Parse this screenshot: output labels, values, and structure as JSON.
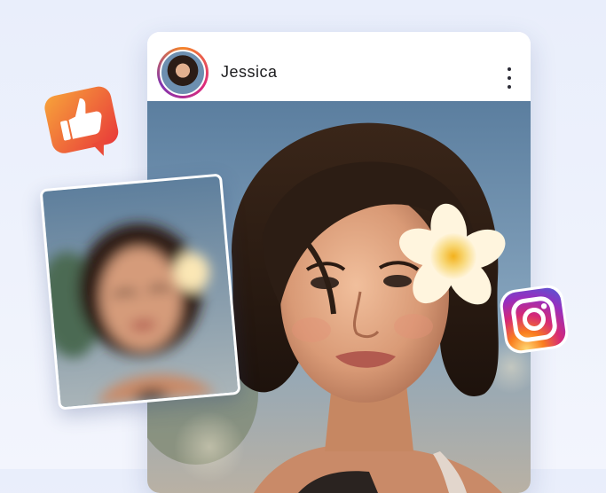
{
  "post": {
    "username": "Jessica",
    "more_icon": "more-vertical-icon",
    "avatar_icon": "profile-avatar"
  },
  "badges": {
    "like_icon": "thumbs-up-icon",
    "instagram_icon": "instagram-icon"
  },
  "colors": {
    "like_gradient_start": "#f7a33a",
    "like_gradient_end": "#e8383a",
    "instagram_gradient": [
      "#feda75",
      "#fa7e1e",
      "#d62976",
      "#962fbf",
      "#4f5bd5"
    ],
    "background": "#eef2fc"
  }
}
